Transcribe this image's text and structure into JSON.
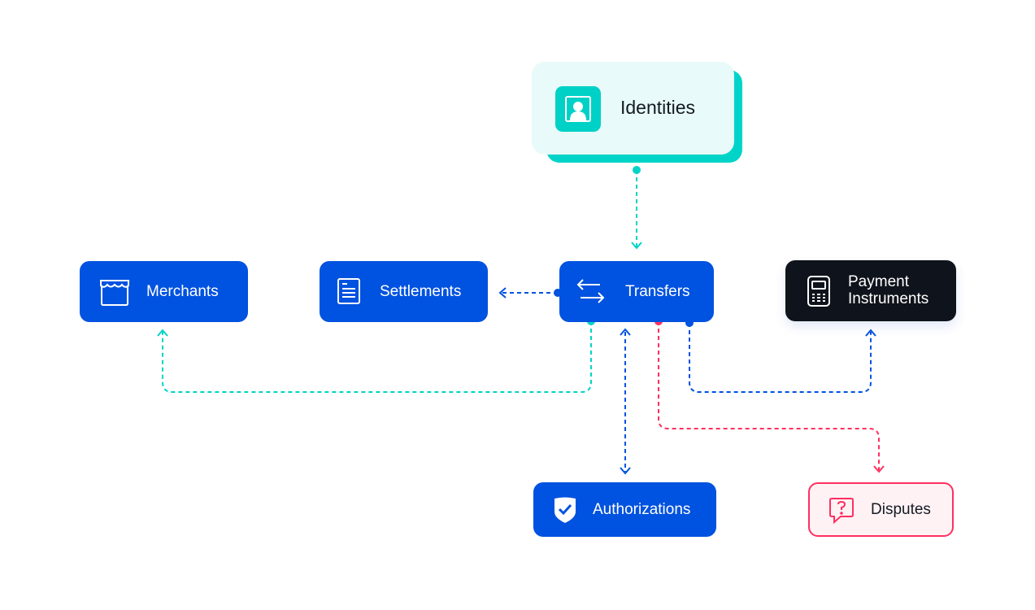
{
  "colors": {
    "blue": "#0052e0",
    "teal": "#00d4c8",
    "red": "#ff2f5f",
    "dark": "#0f131b",
    "teal_bg": "#e8faf9",
    "red_bg": "#fff2f5"
  },
  "nodes": {
    "identities": {
      "label": "Identities",
      "icon": "user-id-icon"
    },
    "merchants": {
      "label": "Merchants",
      "icon": "storefront-icon"
    },
    "settlements": {
      "label": "Settlements",
      "icon": "document-icon"
    },
    "transfers": {
      "label": "Transfers",
      "icon": "arrows-exchange-icon"
    },
    "payment_instruments": {
      "label_line1": "Payment",
      "label_line2": "Instruments",
      "icon": "card-terminal-icon"
    },
    "authorizations": {
      "label": "Authorizations",
      "icon": "shield-check-icon"
    },
    "disputes": {
      "label": "Disputes",
      "icon": "question-bubble-icon"
    }
  },
  "connections": [
    {
      "from": "identities",
      "to": "transfers",
      "color": "teal"
    },
    {
      "from": "transfers",
      "to": "settlements",
      "color": "blue"
    },
    {
      "from": "transfers",
      "to": "merchants",
      "color": "teal"
    },
    {
      "from": "transfers",
      "to": "authorizations",
      "color": "blue",
      "bidirectional": true
    },
    {
      "from": "transfers",
      "to": "disputes",
      "color": "red"
    },
    {
      "from": "transfers",
      "to": "payment_instruments",
      "color": "blue"
    }
  ]
}
